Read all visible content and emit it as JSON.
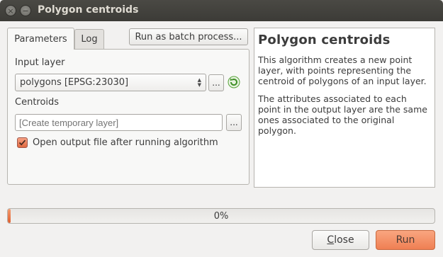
{
  "window": {
    "title": "Polygon centroids",
    "close_glyph": "×",
    "minimize_glyph": "−"
  },
  "tabs": [
    {
      "label": "Parameters",
      "active": true
    },
    {
      "label": "Log",
      "active": false
    }
  ],
  "toolbar": {
    "batch_label": "Run as batch process..."
  },
  "form": {
    "input_layer_label": "Input layer",
    "input_layer_value": "polygons [EPSG:23030]",
    "browse_label": "...",
    "centroids_label": "Centroids",
    "centroids_placeholder": "[Create temporary layer]",
    "centroids_value": "",
    "open_output_label": "Open output file after running algorithm",
    "open_output_checked": true
  },
  "help": {
    "title": "Polygon centroids",
    "paragraphs": [
      "This algorithm creates a new point layer, with points representing the centroid of polygons of an input layer.",
      "The attributes associated to each point in the output layer are the same ones associated to the original polygon."
    ]
  },
  "progress": {
    "text": "0%",
    "value": 0
  },
  "buttons": {
    "close_first": "C",
    "close_rest": "lose",
    "run": "Run"
  },
  "colors": {
    "accent": "#ef7f53",
    "titlebar": "#3c3b37",
    "window_bg": "#f2f1f0"
  },
  "icons": {
    "refresh": "green-refresh-icon",
    "checkmark": "checkmark-icon"
  }
}
